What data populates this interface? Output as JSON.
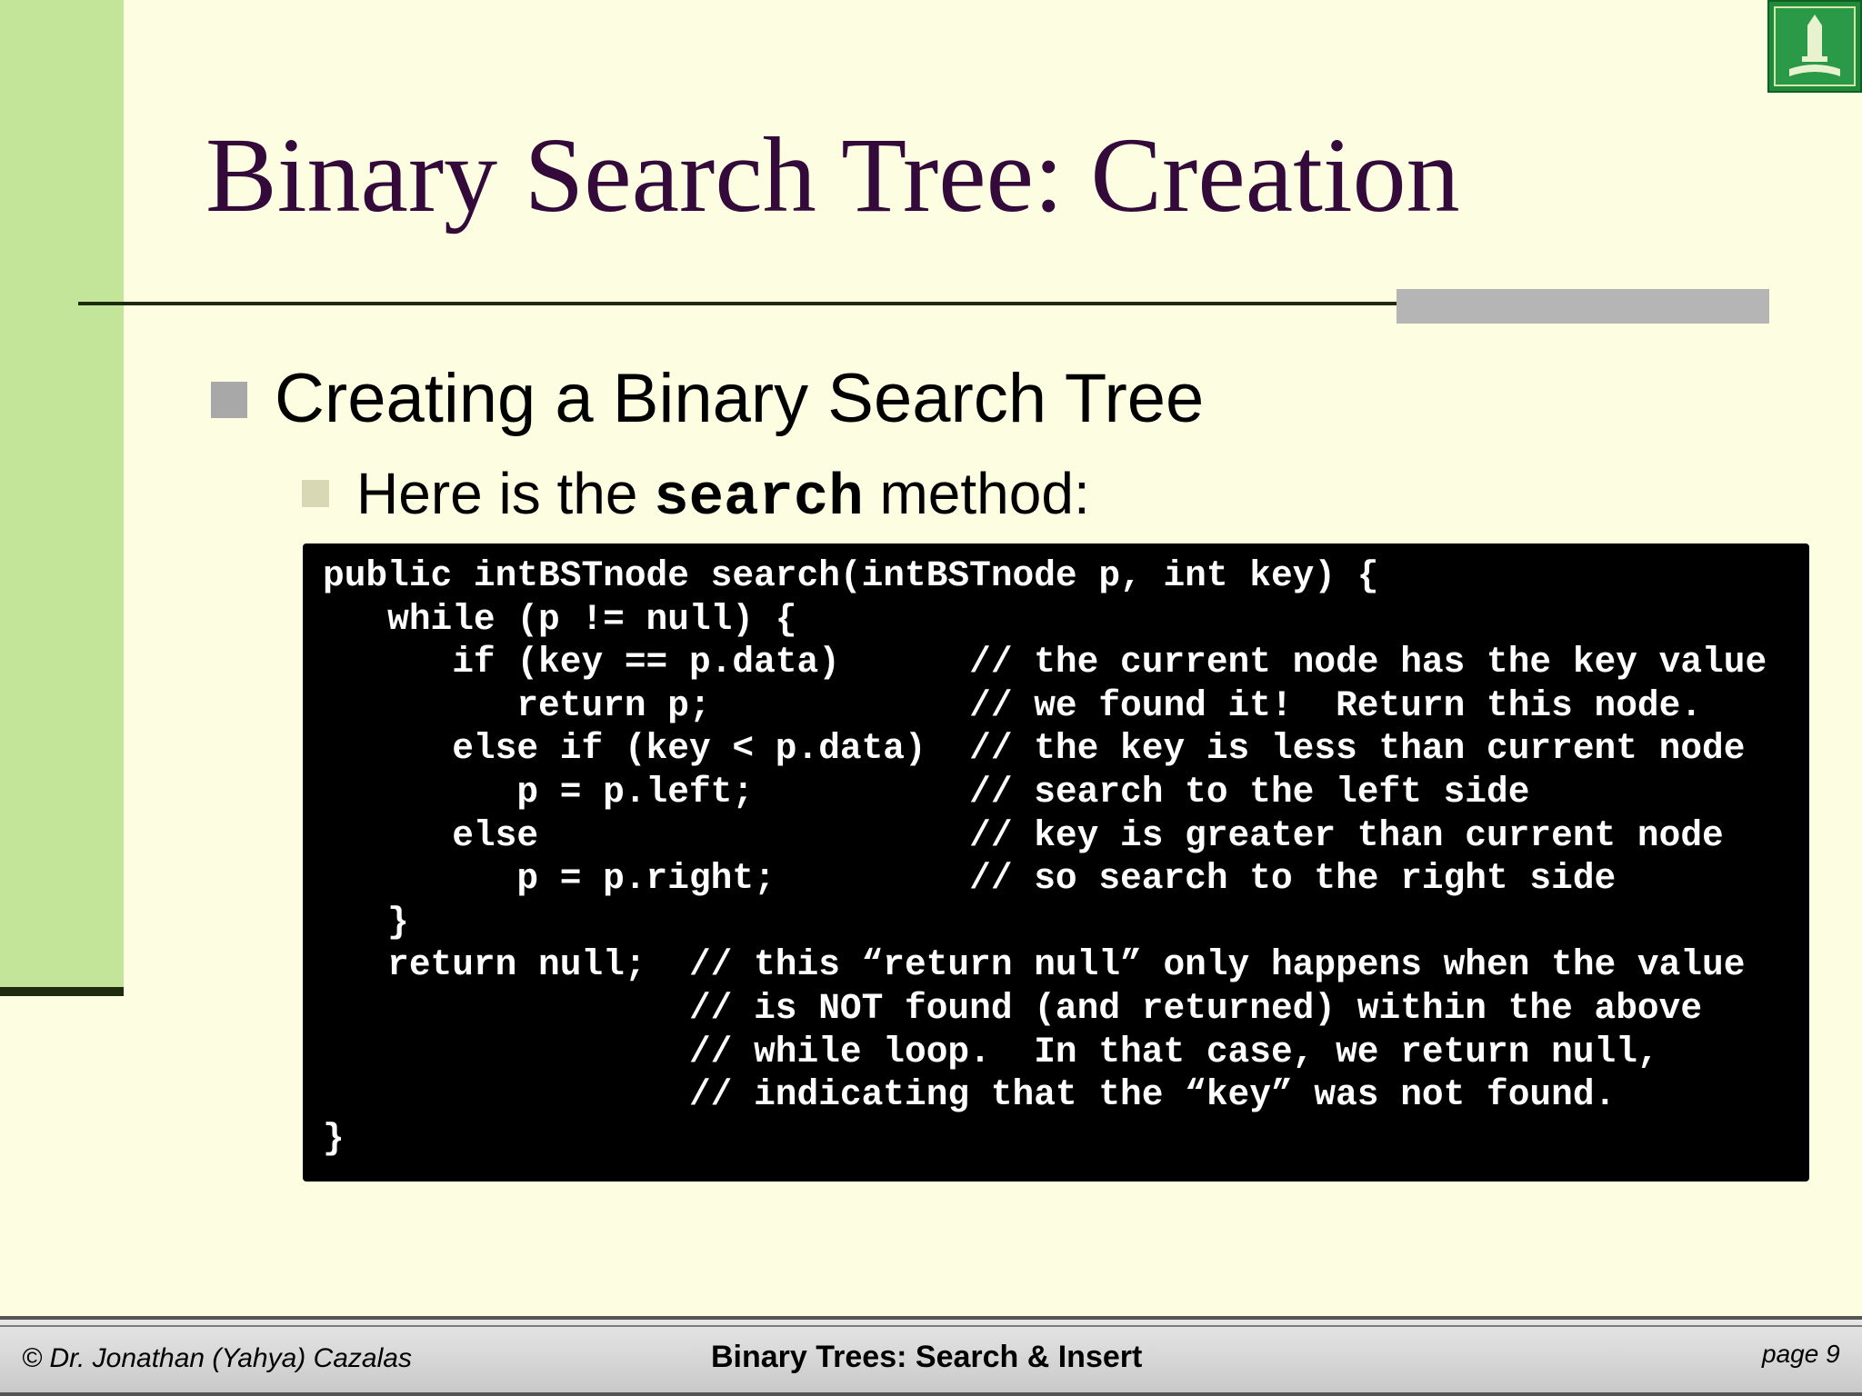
{
  "slide": {
    "title": "Binary Search Tree:  Creation",
    "bullet1": "Creating a Binary Search Tree",
    "bullet2_pre": "Here is the ",
    "bullet2_code": "search",
    "bullet2_post": " method:"
  },
  "code": "public intBSTnode search(intBSTnode p, int key) {\n   while (p != null) {\n      if (key == p.data)      // the current node has the key value\n         return p;            // we found it!  Return this node.\n      else if (key < p.data)  // the key is less than current node\n         p = p.left;          // search to the left side\n      else                    // key is greater than current node\n         p = p.right;         // so search to the right side\n   }\n   return null;  // this “return null” only happens when the value\n                 // is NOT found (and returned) within the above\n                 // while loop.  In that case, we return null,\n                 // indicating that the “key” was not found.\n}",
  "footer": {
    "author": "© Dr. Jonathan (Yahya) Cazalas",
    "course": "Binary Trees:  Search & Insert",
    "page": "page 9"
  },
  "colors": {
    "background": "#fdfde2",
    "left_bar": "#c3e59a",
    "title": "#330a3a",
    "code_bg": "#000000"
  },
  "icons": {
    "logo": "university-logo"
  }
}
